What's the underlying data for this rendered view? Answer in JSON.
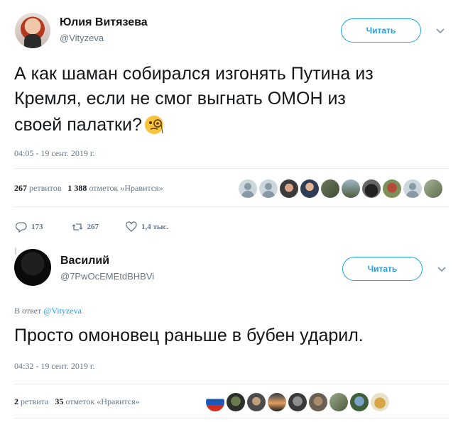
{
  "tweet1": {
    "author_name": "Юлия Витязева",
    "author_handle": "@Vityzeva",
    "follow_label": "Читать",
    "text_lines": [
      "А как шаман собирался изгонять Путина из",
      "Кремля, если не смог выгнать ОМОН из",
      "своей палатки?"
    ],
    "emoji": "🧐",
    "timestamp": "04:05 - 19 сент. 2019 г.",
    "retweets_count": "267",
    "retweets_label": "ретвитов",
    "likes_count": "1 388",
    "likes_label": "отметок «Нравится»",
    "reply_count": "173",
    "retweet_count": "267",
    "like_count": "1,4 тыс."
  },
  "tweet2": {
    "author_name": "Василий",
    "author_handle": "@7PwOcEMEtdBHBVi",
    "follow_label": "Читать",
    "reply_prefix": "В ответ",
    "reply_handle": "@Vityzeva",
    "text": "Просто омоновец раньше в бубен ударил.",
    "timestamp": "04:32 - 19 сент. 2019 г.",
    "retweets_count": "2",
    "retweets_label": "ретвита",
    "likes_count": "35",
    "likes_label": "отметок «Нравится»"
  },
  "icons": {
    "chevron": "chevron-down-icon",
    "reply": "reply-icon",
    "retweet": "retweet-icon",
    "like": "heart-icon",
    "monocle_emoji": "face-with-monocle"
  },
  "colors": {
    "accent": "#1da1f2",
    "secondary_text": "#657786",
    "divider": "#e6ecf0"
  }
}
